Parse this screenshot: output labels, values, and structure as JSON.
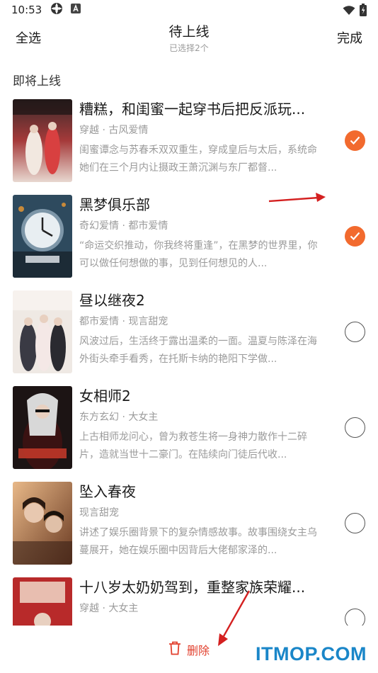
{
  "status_bar": {
    "time": "10:53",
    "icons": [
      "settings-gear-icon",
      "text-a-icon",
      "wifi-icon",
      "battery-charging-icon"
    ]
  },
  "header": {
    "select_all": "全选",
    "title": "待上线",
    "subtitle": "已选择2个",
    "done": "完成"
  },
  "section": {
    "title": "即将上线"
  },
  "books": [
    {
      "title": "糟糕，和闺蜜一起穿书后把反派玩...",
      "tags": "穿越 · 古风爱情",
      "desc": "闺蜜谭念与苏春禾双双重生，穿成皇后与太后，系统命她们在三个月内让摄政王萧沉渊与东厂都督...",
      "checked": true
    },
    {
      "title": "黑梦俱乐部",
      "tags": "奇幻爱情 · 都市爱情",
      "desc": "“命运交织推动，你我终将重逢”，在黑梦的世界里，你可以做任何想做的事，见到任何想见的人...",
      "checked": true
    },
    {
      "title": "昼以继夜2",
      "tags": "都市爱情 · 现言甜宠",
      "desc": "风波过后，生活终于露出温柔的一面。温夏与陈泽在海外街头牵手看秀，在托斯卡纳的艳阳下学做...",
      "checked": false
    },
    {
      "title": "女相师2",
      "tags": "东方玄幻 · 大女主",
      "desc": "上古相师龙问心，曾为救苍生将一身神力散作十二碎片，造就当世十二豪门。在陆续向门徒后代收...",
      "checked": false
    },
    {
      "title": "坠入春夜",
      "tags": "现言甜宠",
      "desc": "讲述了娱乐圈背景下的复杂情感故事。故事围绕女主乌蔓展开，她在娱乐圈中因背后大佬郁家泽的...",
      "checked": false
    },
    {
      "title": "十八岁太奶奶驾到，重整家族荣耀...",
      "tags": "穿越 · 大女主",
      "desc": "",
      "checked": false
    }
  ],
  "bottom": {
    "delete_label": "删除"
  },
  "watermark": "ITMOP.COM",
  "colors": {
    "accent": "#f26a2e",
    "delete": "#e2402e",
    "watermark": "#1a86c8",
    "annotation_arrow": "#d42020"
  }
}
